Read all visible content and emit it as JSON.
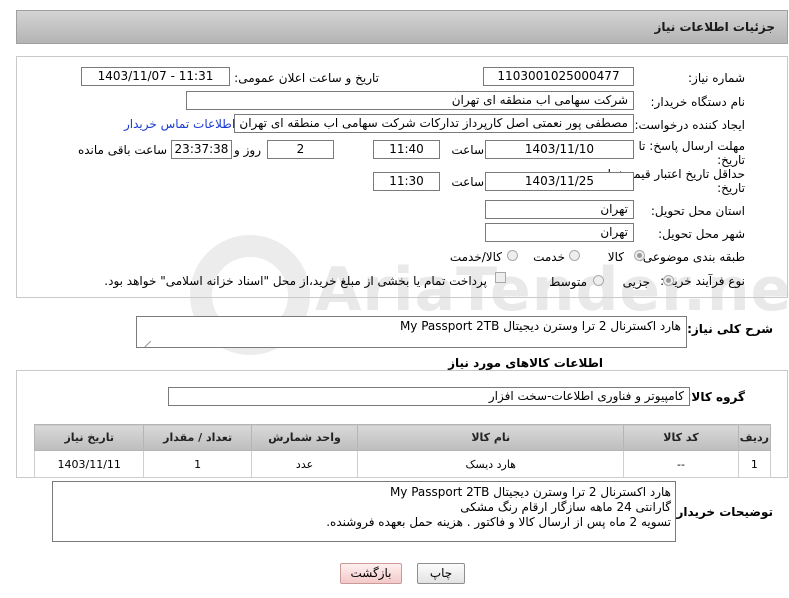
{
  "header": {
    "title": "جزئیات اطلاعات نیاز"
  },
  "watermark": {
    "text": "AriaTender.net"
  },
  "form": {
    "need_number_label": "شماره نیاز:",
    "need_number": "1103001025000477",
    "announce_label": "تاریخ و ساعت اعلان عمومی:",
    "announce_value": "1403/11/07 - 11:31",
    "buyer_label": "نام دستگاه خریدار:",
    "buyer_value": "شرکت سهامی اب منطقه ای تهران",
    "creator_label": "ایجاد کننده درخواست:",
    "creator_value": "مصطفی پور نعمتی اصل کارپرداز تدارکات شرکت سهامی اب منطقه ای تهران",
    "contact_link": "اطلاعات تماس خریدار",
    "deadline_label_1": "مهلت ارسال پاسخ: تا",
    "deadline_label_2": "تاریخ:",
    "deadline_date": "1403/11/10",
    "time_label": "ساعت",
    "deadline_time": "11:40",
    "days_value": "2",
    "days_label": "روز و",
    "remaining_value": "23:37:38",
    "remaining_label": "ساعت باقی مانده",
    "validity_label_1": "حداقل تاریخ اعتبار قیمت: تا",
    "validity_label_2": "تاریخ:",
    "validity_date": "1403/11/25",
    "validity_time": "11:30",
    "province_label": "استان محل تحویل:",
    "province_value": "تهران",
    "city_label": "شهر محل تحویل:",
    "city_value": "تهران",
    "category_label": "طبقه بندی موضوعی:",
    "category_options": [
      "کالا",
      "خدمت",
      "کالا/خدمت"
    ],
    "process_label": "نوع فرآیند خرید :",
    "process_options": [
      "جزیی",
      "متوسط"
    ],
    "process_note": "پرداخت تمام یا بخشی از مبلغ خرید،از محل \"اسناد خزانه اسلامی\" خواهد بود."
  },
  "summary": {
    "label": "شرح کلی نیاز:",
    "value": "هارد اکسترنال 2 ترا وسترن دیجیتال My Passport 2TB"
  },
  "goods": {
    "section_title": "اطلاعات کالاهای مورد نیاز",
    "group_label": "گروه کالا:",
    "group_value": "کامپیوتر و فناوری اطلاعات-سخت افزار"
  },
  "table": {
    "headers": [
      "ردیف",
      "کد کالا",
      "نام کالا",
      "واحد شمارش",
      "تعداد / مقدار",
      "تاریخ نیاز"
    ],
    "rows": [
      [
        "1",
        "--",
        "هارد دیسک",
        "عدد",
        "1",
        "1403/11/11"
      ]
    ]
  },
  "buyer_notes": {
    "label": "توضیحات خریدار:",
    "lines": [
      "هارد اکسترنال 2 ترا وسترن دیجیتال My Passport 2TB",
      "گارانتی 24 ماهه سازگار ارقام رنگ مشکی",
      "تسویه 2 ماه پس از ارسال کالا و فاکتور  . هزینه حمل بعهده فروشنده."
    ]
  },
  "buttons": {
    "print": "چاپ",
    "back": "بازگشت"
  }
}
